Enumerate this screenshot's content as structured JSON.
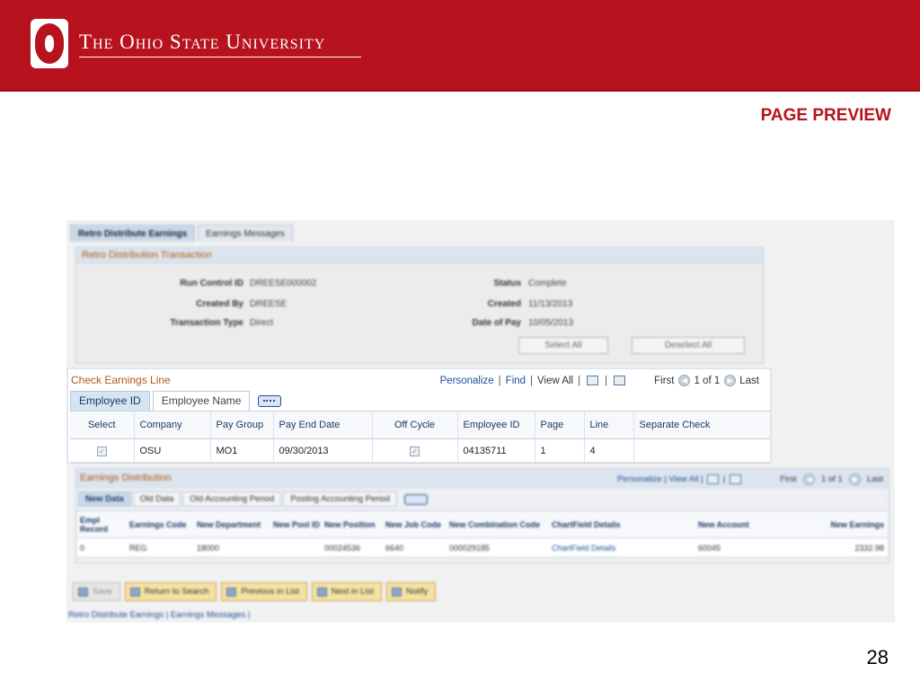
{
  "header": {
    "university_name": "The Ohio State University",
    "page_label": "PAGE PREVIEW",
    "slide_number": "28"
  },
  "page_tabs": [
    "Retro Distribute Earnings",
    "Earnings Messages"
  ],
  "transaction": {
    "title": "Retro Distribution Transaction",
    "fields_left": [
      {
        "label": "Run Control ID",
        "value": "DREESE000002"
      },
      {
        "label": "Created By",
        "value": "DREESE"
      },
      {
        "label": "Transaction Type",
        "value": "Direct"
      }
    ],
    "fields_right": [
      {
        "label": "Status",
        "value": "Complete"
      },
      {
        "label": "Created",
        "value": "11/13/2013"
      },
      {
        "label": "Date of Pay",
        "value": "10/05/2013"
      }
    ],
    "select_all": "Select All",
    "deselect_all": "Deselect All"
  },
  "check_earnings": {
    "title": "Check Earnings Line",
    "nav": {
      "personalize": "Personalize",
      "find": "Find",
      "view_all": "View All",
      "first": "First",
      "range": "1 of 1",
      "last": "Last"
    },
    "tabs": [
      "Employee ID",
      "Employee Name"
    ],
    "columns": [
      "Select",
      "Company",
      "Pay Group",
      "Pay End Date",
      "Off Cycle",
      "Employee ID",
      "Page",
      "Line",
      "Separate Check"
    ],
    "row": {
      "select": "✓",
      "company": "OSU",
      "pay_group": "MO1",
      "pay_end_date": "09/30/2013",
      "off_cycle": "✓",
      "employee_id": "04135711",
      "page": "1",
      "line": "4",
      "separate_check": ""
    }
  },
  "earnings_distribution": {
    "title": "Earnings Distribution",
    "nav": {
      "personalize": "Personalize",
      "view_all": "View All",
      "first": "First",
      "range": "1 of 1",
      "last": "Last"
    },
    "tabs": [
      "New Data",
      "Old Data",
      "Old Accounting Period",
      "Posting Accounting Period"
    ],
    "columns": [
      "Empl Record",
      "Earnings Code",
      "New Department",
      "New Pool ID",
      "New Position",
      "New Job Code",
      "New Combination Code",
      "ChartField Details",
      "New Account",
      "New Earnings"
    ],
    "row": {
      "empl_record": "0",
      "earnings_code": "REG",
      "new_department": "18000",
      "new_pool_id": "",
      "new_position": "00024536",
      "new_job_code": "6640",
      "new_combination_code": "000029185",
      "chartfield_details": "ChartField Details",
      "new_account": "60045",
      "new_earnings": "2332.98"
    }
  },
  "toolbar": {
    "save": "Save",
    "return_to_search": "Return to Search",
    "previous_in_list": "Previous in List",
    "next_in_list": "Next in List",
    "notify": "Notify"
  },
  "footer_links": "Retro Distribute Earnings | Earnings Messages |"
}
